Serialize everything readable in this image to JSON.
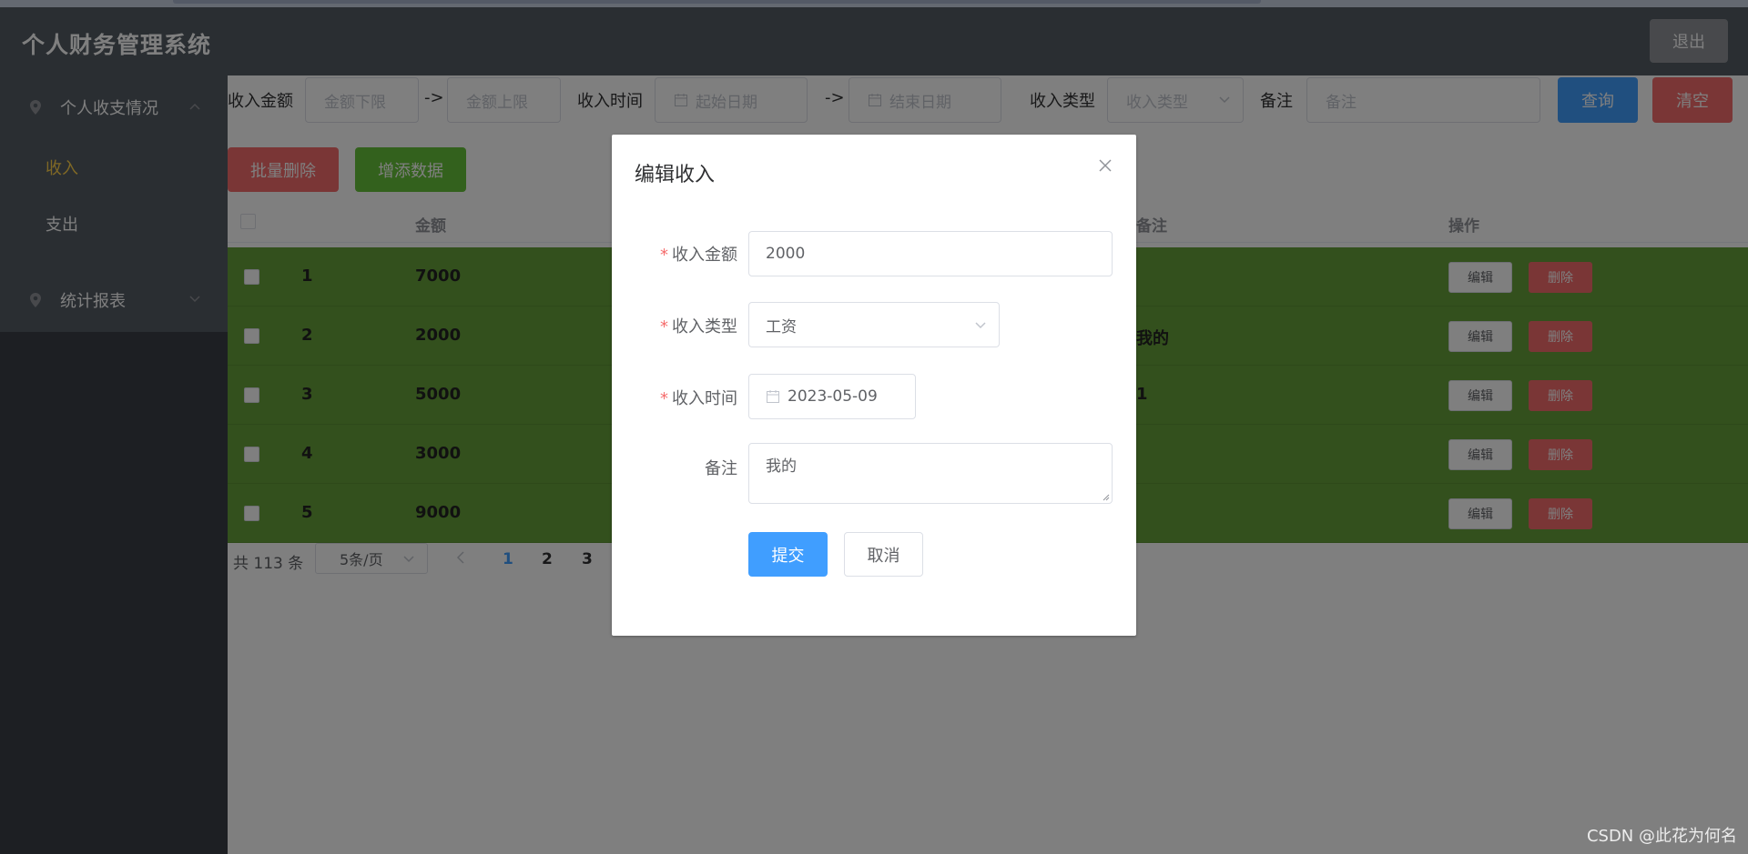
{
  "header": {
    "title": "个人财务管理系统",
    "logout_label": "退出"
  },
  "sidebar": {
    "groups": [
      {
        "label": "个人收支情况",
        "icon": "location-pin-icon",
        "expanded": true
      },
      {
        "label": "统计报表",
        "icon": "location-pin-icon",
        "expanded": false
      }
    ],
    "sub_items": [
      {
        "label": "收入",
        "active": true
      },
      {
        "label": "支出",
        "active": false
      }
    ],
    "active_color": "#ffd04b"
  },
  "filters": {
    "amount_label": "收入金额",
    "amount_min_placeholder": "金额下限",
    "arrow": "->",
    "amount_max_placeholder": "金额上限",
    "time_label": "收入时间",
    "start_date_placeholder": "起始日期",
    "end_date_placeholder": "结束日期",
    "type_label": "收入类型",
    "type_placeholder": "收入类型",
    "note_label": "备注",
    "note_placeholder": "备注",
    "query_label": "查询",
    "clear_label": "清空"
  },
  "actions": {
    "batch_delete_label": "批量删除",
    "add_label": "增添数据"
  },
  "table": {
    "columns": {
      "amount": "金额",
      "note": "备注",
      "ops": "操作"
    },
    "rows": [
      {
        "id": "1",
        "amount": "7000",
        "note": ""
      },
      {
        "id": "2",
        "amount": "2000",
        "note": "我的"
      },
      {
        "id": "3",
        "amount": "5000",
        "note": "1"
      },
      {
        "id": "4",
        "amount": "3000",
        "note": ""
      },
      {
        "id": "5",
        "amount": "9000",
        "note": ""
      }
    ],
    "edit_label": "编辑",
    "delete_label": "删除",
    "row_color": "#67a13a"
  },
  "pagination": {
    "total": "共 113 条",
    "page_size": "5条/页",
    "pages": [
      "1",
      "2",
      "3"
    ],
    "current": "1"
  },
  "dialog": {
    "title": "编辑收入",
    "required_mark": "*",
    "amount_label": "收入金额",
    "amount_value": "2000",
    "type_label": "收入类型",
    "type_value": "工资",
    "time_label": "收入时间",
    "time_value": "2023-05-09",
    "note_label": "备注",
    "note_value": "我的",
    "submit_label": "提交",
    "cancel_label": "取消"
  },
  "watermark": "CSDN @此花为何名",
  "colors": {
    "primary": "#409eff",
    "danger": "#f56c6c",
    "success": "#67c23a",
    "header": "#545c64"
  }
}
